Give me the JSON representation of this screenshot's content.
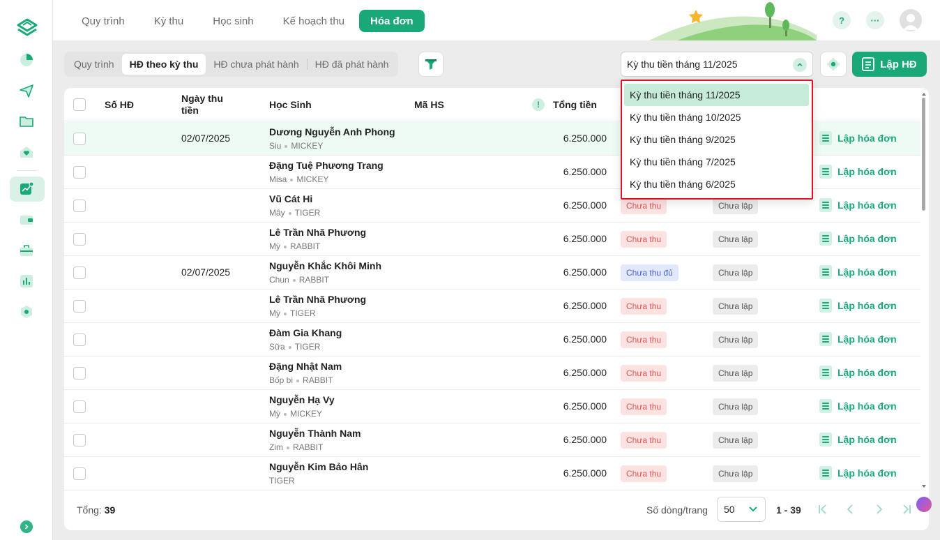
{
  "topbar": {
    "tabs": [
      "Quy trình",
      "Kỳ thu",
      "Học sinh",
      "Kế hoạch thu",
      "Hóa đơn"
    ],
    "help": "?",
    "more": "···"
  },
  "subtabs": [
    "Quy trình",
    "HĐ theo kỳ thu",
    "HĐ chưa phát hành",
    "HĐ đã phát hành"
  ],
  "period": {
    "selected": "Kỳ thu tiền tháng 11/2025",
    "options": [
      "Kỳ thu tiền tháng 11/2025",
      "Kỳ thu tiền tháng 10/2025",
      "Kỳ thu tiền tháng 9/2025",
      "Kỳ thu tiền tháng 7/2025",
      "Kỳ thu tiền tháng 6/2025"
    ]
  },
  "create_label": "Lập HĐ",
  "table": {
    "headers": {
      "invoice_no": "Số HĐ",
      "date": "Ngày thu tiền",
      "student": "Học Sinh",
      "code": "Mã HS",
      "warn": "!",
      "total": "Tổng tiền"
    },
    "rows": [
      {
        "date": "02/07/2025",
        "name": "Dương Nguyễn Anh Phong",
        "nick": "Siu",
        "class": "MICKEY",
        "amount": "6.250.000",
        "pay": "",
        "inv": "",
        "action": "Lập hóa đơn"
      },
      {
        "date": "",
        "name": "Đặng Tuệ Phương Trang",
        "nick": "Misa",
        "class": "MICKEY",
        "amount": "6.250.000",
        "pay": "",
        "inv": "",
        "action": "Lập hóa đơn"
      },
      {
        "date": "",
        "name": "Vũ Cát Hi",
        "nick": "Mây",
        "class": "TIGER",
        "amount": "6.250.000",
        "pay": "Chưa thu",
        "inv": "Chưa lập",
        "action": "Lập hóa đơn"
      },
      {
        "date": "",
        "name": "Lê Trần Nhã Phương",
        "nick": "Mỳ",
        "class": "RABBIT",
        "amount": "6.250.000",
        "pay": "Chưa thu",
        "inv": "Chưa lập",
        "action": "Lập hóa đơn"
      },
      {
        "date": "02/07/2025",
        "name": "Nguyễn Khắc Khôi Minh",
        "nick": "Chun",
        "class": "RABBIT",
        "amount": "6.250.000",
        "pay": "Chưa thu đủ",
        "inv": "Chưa lập",
        "action": "Lập hóa đơn"
      },
      {
        "date": "",
        "name": "Lê Trần Nhã Phương",
        "nick": "Mỳ",
        "class": "TIGER",
        "amount": "6.250.000",
        "pay": "Chưa thu",
        "inv": "Chưa lập",
        "action": "Lập hóa đơn"
      },
      {
        "date": "",
        "name": "Đàm Gia Khang",
        "nick": "Sữa",
        "class": "TIGER",
        "amount": "6.250.000",
        "pay": "Chưa thu",
        "inv": "Chưa lập",
        "action": "Lập hóa đơn"
      },
      {
        "date": "",
        "name": "Đặng Nhật Nam",
        "nick": "Bốp bi",
        "class": "RABBIT",
        "amount": "6.250.000",
        "pay": "Chưa thu",
        "inv": "Chưa lập",
        "action": "Lập hóa đơn"
      },
      {
        "date": "",
        "name": "Nguyễn Hạ Vy",
        "nick": "Mỳ",
        "class": "MICKEY",
        "amount": "6.250.000",
        "pay": "Chưa thu",
        "inv": "Chưa lập",
        "action": "Lập hóa đơn"
      },
      {
        "date": "",
        "name": "Nguyễn Thành Nam",
        "nick": "Zim",
        "class": "RABBIT",
        "amount": "6.250.000",
        "pay": "Chưa thu",
        "inv": "Chưa lập",
        "action": "Lập hóa đơn"
      },
      {
        "date": "",
        "name": "Nguyễn Kim Bảo Hân",
        "nick": "",
        "class": "TIGER",
        "amount": "6.250.000",
        "pay": "Chưa thu",
        "inv": "Chưa lập",
        "action": "Lập hóa đơn"
      }
    ]
  },
  "footer": {
    "total_label": "Tổng:",
    "total_value": "39",
    "rows_label": "Số dòng/trang",
    "rows_value": "50",
    "range": "1 - 39"
  },
  "colors": {
    "accent": "#19a979",
    "unpaid": "#e25555",
    "partial": "#4a62d6",
    "highlight_border": "#e0141e"
  }
}
